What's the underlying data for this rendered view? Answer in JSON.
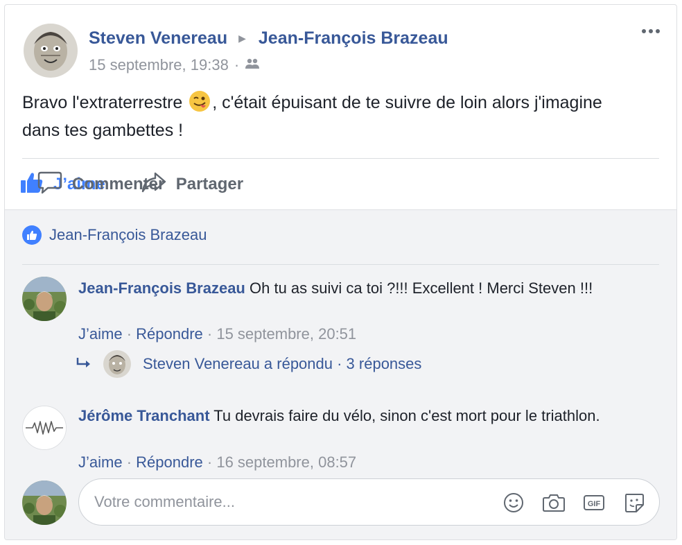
{
  "post": {
    "author": "Steven Venereau",
    "target": "Jean-François Brazeau",
    "timestamp": "15 septembre, 19:38",
    "dot": "·",
    "audience_icon": "friends-icon",
    "text_before": "Bravo l'extraterrestre ",
    "emoji": "winking-face-tongue",
    "text_after": ", c'était épuisant de te suivre de loin alors j'imagine dans tes gambettes !"
  },
  "actions": {
    "like_label": "J’aime",
    "comment_label": "Commenter",
    "share_label": "Partager"
  },
  "likes": {
    "names": "Jean-François Brazeau"
  },
  "comments": [
    {
      "author": "Jean-François Brazeau",
      "text": "Oh tu as suivi ca toi ?!!! Excellent ! Merci Steven !!!",
      "like_label": "J’aime",
      "sep": " · ",
      "reply_label": "Répondre",
      "timestamp": "15 septembre, 20:51",
      "replies_summary": "Steven Venereau a répondu · 3 réponses"
    },
    {
      "author": "Jérôme Tranchant",
      "text": "Tu devrais faire du vélo, sinon c'est mort pour le triathlon.",
      "like_label": "J’aime",
      "sep": " · ",
      "reply_label": "Répondre",
      "timestamp": "16 septembre, 08:57"
    }
  ],
  "composer": {
    "placeholder": "Votre commentaire...",
    "icons": [
      "emoji-icon",
      "camera-icon",
      "gif-icon",
      "sticker-icon"
    ],
    "gif_label": "GIF"
  },
  "colors": {
    "link": "#385898",
    "like_blue": "#4080ff",
    "muted": "#90949c",
    "comment_bg": "#f2f3f5"
  }
}
